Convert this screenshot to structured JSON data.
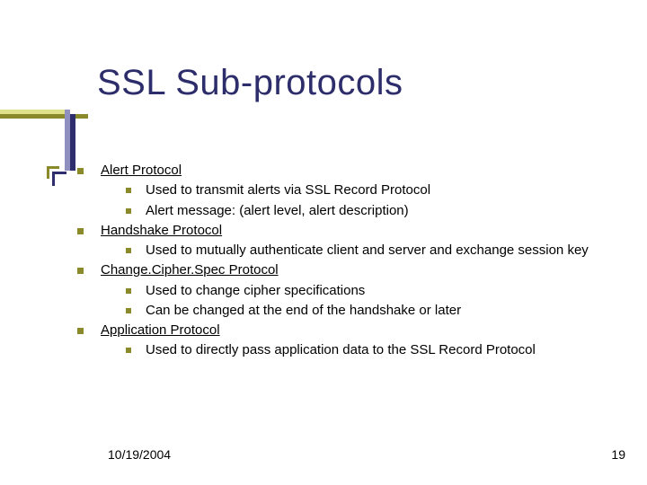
{
  "title": "SSL Sub-protocols",
  "items": [
    {
      "head": "Alert Protocol",
      "subs": [
        "Used to transmit alerts via SSL Record Protocol",
        "Alert message: (alert level, alert description)"
      ]
    },
    {
      "head": "Handshake Protocol",
      "subs": [
        "Used to mutually authenticate client and server and exchange session key"
      ]
    },
    {
      "head": "Change.Cipher.Spec Protocol",
      "subs": [
        "Used to change cipher specifications",
        "Can be changed at the end of the handshake or later"
      ]
    },
    {
      "head": "Application Protocol",
      "subs": [
        "Used to directly pass application data to the SSL Record Protocol"
      ]
    }
  ],
  "footer": {
    "date": "10/19/2004",
    "page": "19"
  },
  "colors": {
    "title": "#2d2d6b",
    "bullet": "#8a8a2a"
  }
}
